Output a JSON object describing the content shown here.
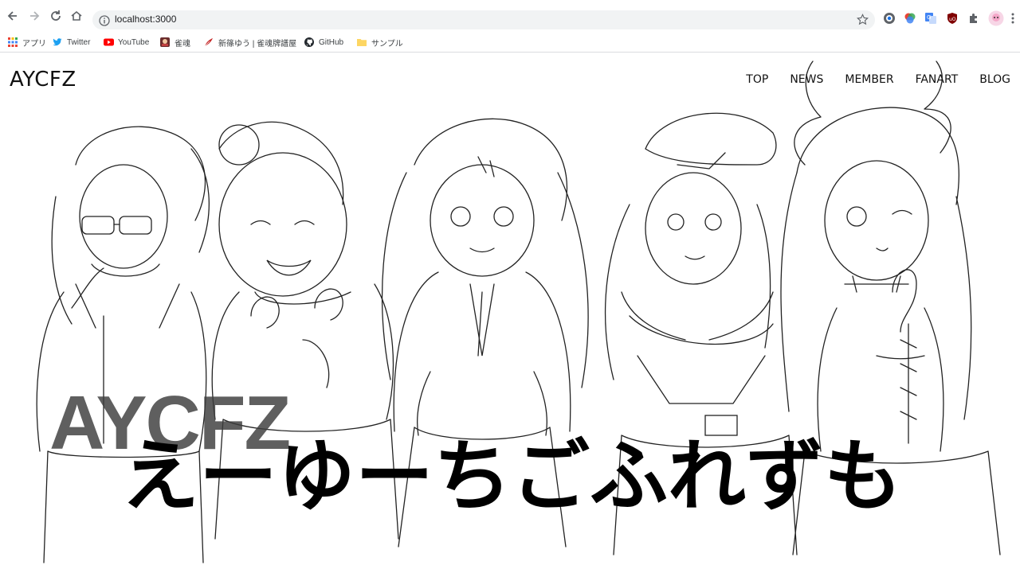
{
  "browser": {
    "url": "localhost:3000",
    "bookmarks": [
      {
        "label": "アプリ",
        "icon": "apps-grid-icon"
      },
      {
        "label": "Twitter",
        "icon": "twitter-icon"
      },
      {
        "label": "YouTube",
        "icon": "youtube-icon"
      },
      {
        "label": "雀魂",
        "icon": "mahjong-icon"
      },
      {
        "label": "新篠ゆう | 雀魂牌譜屋",
        "icon": "feather-icon"
      },
      {
        "label": "GitHub",
        "icon": "github-icon"
      },
      {
        "label": "サンプル",
        "icon": "folder-icon"
      }
    ]
  },
  "site": {
    "brand": "AYCFZ",
    "nav": [
      "TOP",
      "NEWS",
      "MEMBER",
      "FANART",
      "BLOG"
    ],
    "hero_latin": "AYCFZ",
    "hero_jp": "えーゆーちごふれずも"
  },
  "colors": {
    "chrome_bg": "#ffffff",
    "omnibox_bg": "#f1f3f4",
    "text": "#111111",
    "hero_overlay": "#3c3c3c"
  }
}
